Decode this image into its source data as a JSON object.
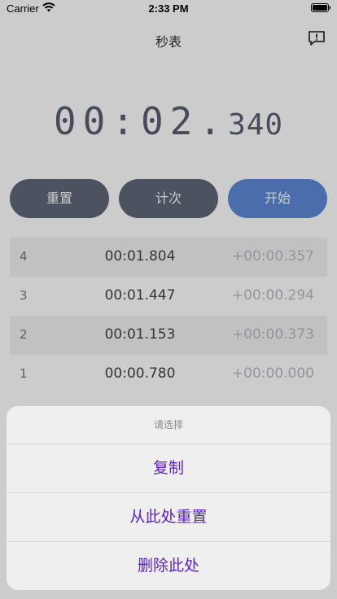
{
  "status_bar": {
    "carrier": "Carrier",
    "time": "2:33 PM",
    "wifi_icon": "wifi-icon",
    "battery_icon": "battery-icon"
  },
  "nav": {
    "title": "秒表",
    "right_icon": "feedback-icon"
  },
  "timer": {
    "main": "00:02.",
    "ms": "340"
  },
  "buttons": {
    "reset": "重置",
    "lap": "计次",
    "start": "开始"
  },
  "laps": [
    {
      "index": "4",
      "time": "00:01.804",
      "diff": "+00:00.357"
    },
    {
      "index": "3",
      "time": "00:01.447",
      "diff": "+00:00.294"
    },
    {
      "index": "2",
      "time": "00:01.153",
      "diff": "+00:00.373"
    },
    {
      "index": "1",
      "time": "00:00.780",
      "diff": "+00:00.000"
    }
  ],
  "action_sheet": {
    "title": "请选择",
    "actions": [
      "复制",
      "从此处重置",
      "删除此处"
    ]
  },
  "colors": {
    "accent": "#5a22c8",
    "button_gray": "#5f6778",
    "button_blue": "#5d8ad7"
  }
}
